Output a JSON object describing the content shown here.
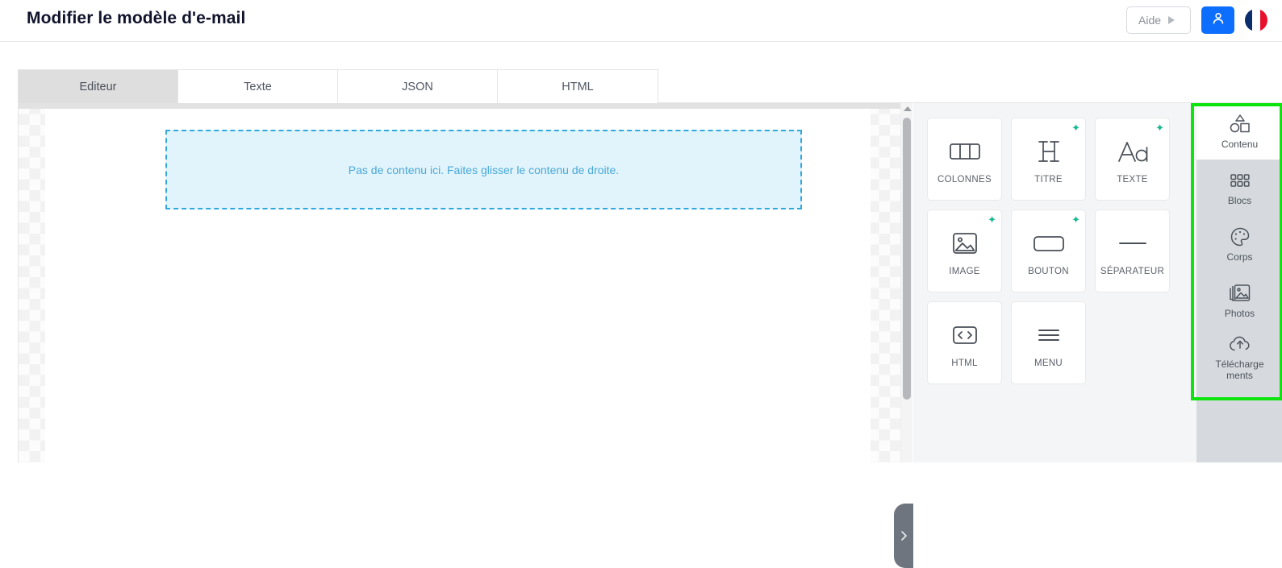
{
  "header": {
    "title": "Modifier le modèle d'e-mail",
    "help_label": "Aide",
    "help_icon": "play-triangle-icon",
    "user_icon": "user-avatar-icon",
    "flag_icon": "french-flag-icon",
    "accent_color": "#0d6efd"
  },
  "tabs": [
    {
      "label": "Editeur",
      "active": true
    },
    {
      "label": "Texte",
      "active": false
    },
    {
      "label": "JSON",
      "active": false
    },
    {
      "label": "HTML",
      "active": false
    }
  ],
  "canvas": {
    "dropzone_text": "Pas de contenu ici. Faites glisser le contenu de droite.",
    "dropzone_border_color": "#31a9dd",
    "dropzone_fill_color": "#e1f4fb",
    "collapse_icon": "chevron-right-icon",
    "scroll_up_icon": "caret-up-icon"
  },
  "content_panel": {
    "tiles": [
      {
        "label": "COLONNES",
        "icon": "columns-icon",
        "ai_badge": false
      },
      {
        "label": "TITRE",
        "icon": "heading-h-icon",
        "ai_badge": true
      },
      {
        "label": "TEXTE",
        "icon": "text-aa-icon",
        "ai_badge": true
      },
      {
        "label": "IMAGE",
        "icon": "image-icon",
        "ai_badge": true
      },
      {
        "label": "BOUTON",
        "icon": "button-icon",
        "ai_badge": true
      },
      {
        "label": "SÉPARATEUR",
        "icon": "divider-line-icon",
        "ai_badge": false
      },
      {
        "label": "HTML",
        "icon": "code-brackets-icon",
        "ai_badge": false
      },
      {
        "label": "MENU",
        "icon": "hamburger-menu-icon",
        "ai_badge": false
      }
    ],
    "ai_badge_glyph": "✦",
    "ai_badge_color": "#18b890"
  },
  "side_nav": {
    "highlight_color": "#0de40d",
    "items": [
      {
        "label": "Contenu",
        "icon": "shapes-icon",
        "active": true
      },
      {
        "label": "Blocs",
        "icon": "grid-dots-icon",
        "active": false
      },
      {
        "label": "Corps",
        "icon": "palette-icon",
        "active": false
      },
      {
        "label": "Photos",
        "icon": "photos-stack-icon",
        "active": false
      },
      {
        "label": "Télécharge ments",
        "icon": "cloud-upload-icon",
        "active": false
      }
    ]
  }
}
